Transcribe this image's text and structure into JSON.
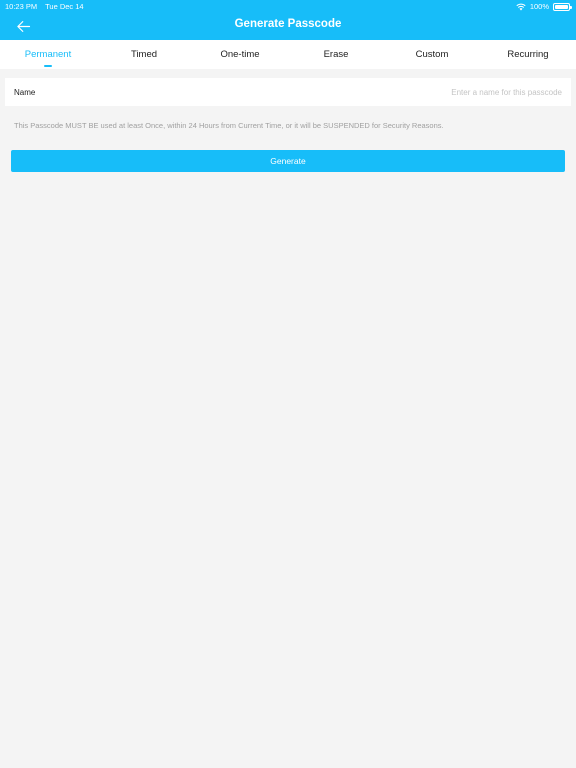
{
  "status_bar": {
    "time": "10:23 PM",
    "date": "Tue Dec 14",
    "battery": "100%",
    "icons": [
      "wifi-icon",
      "battery-icon"
    ]
  },
  "header": {
    "title": "Generate Passcode",
    "back_icon": "arrow-left-icon"
  },
  "tabs": [
    {
      "label": "Permanent",
      "active": true
    },
    {
      "label": "Timed",
      "active": false
    },
    {
      "label": "One-time",
      "active": false
    },
    {
      "label": "Erase",
      "active": false
    },
    {
      "label": "Custom",
      "active": false
    },
    {
      "label": "Recurring",
      "active": false
    }
  ],
  "form": {
    "name_label": "Name",
    "name_value": "",
    "name_placeholder": "Enter a name for this passcode",
    "notice": "This Passcode MUST BE used at least Once, within 24 Hours from Current Time, or it will be SUSPENDED for Security Reasons.",
    "generate_label": "Generate"
  },
  "colors": {
    "accent": "#17bdf9",
    "background": "#f4f4f4",
    "placeholder": "#c4c4c4",
    "notice_text": "#a0a0a0"
  }
}
